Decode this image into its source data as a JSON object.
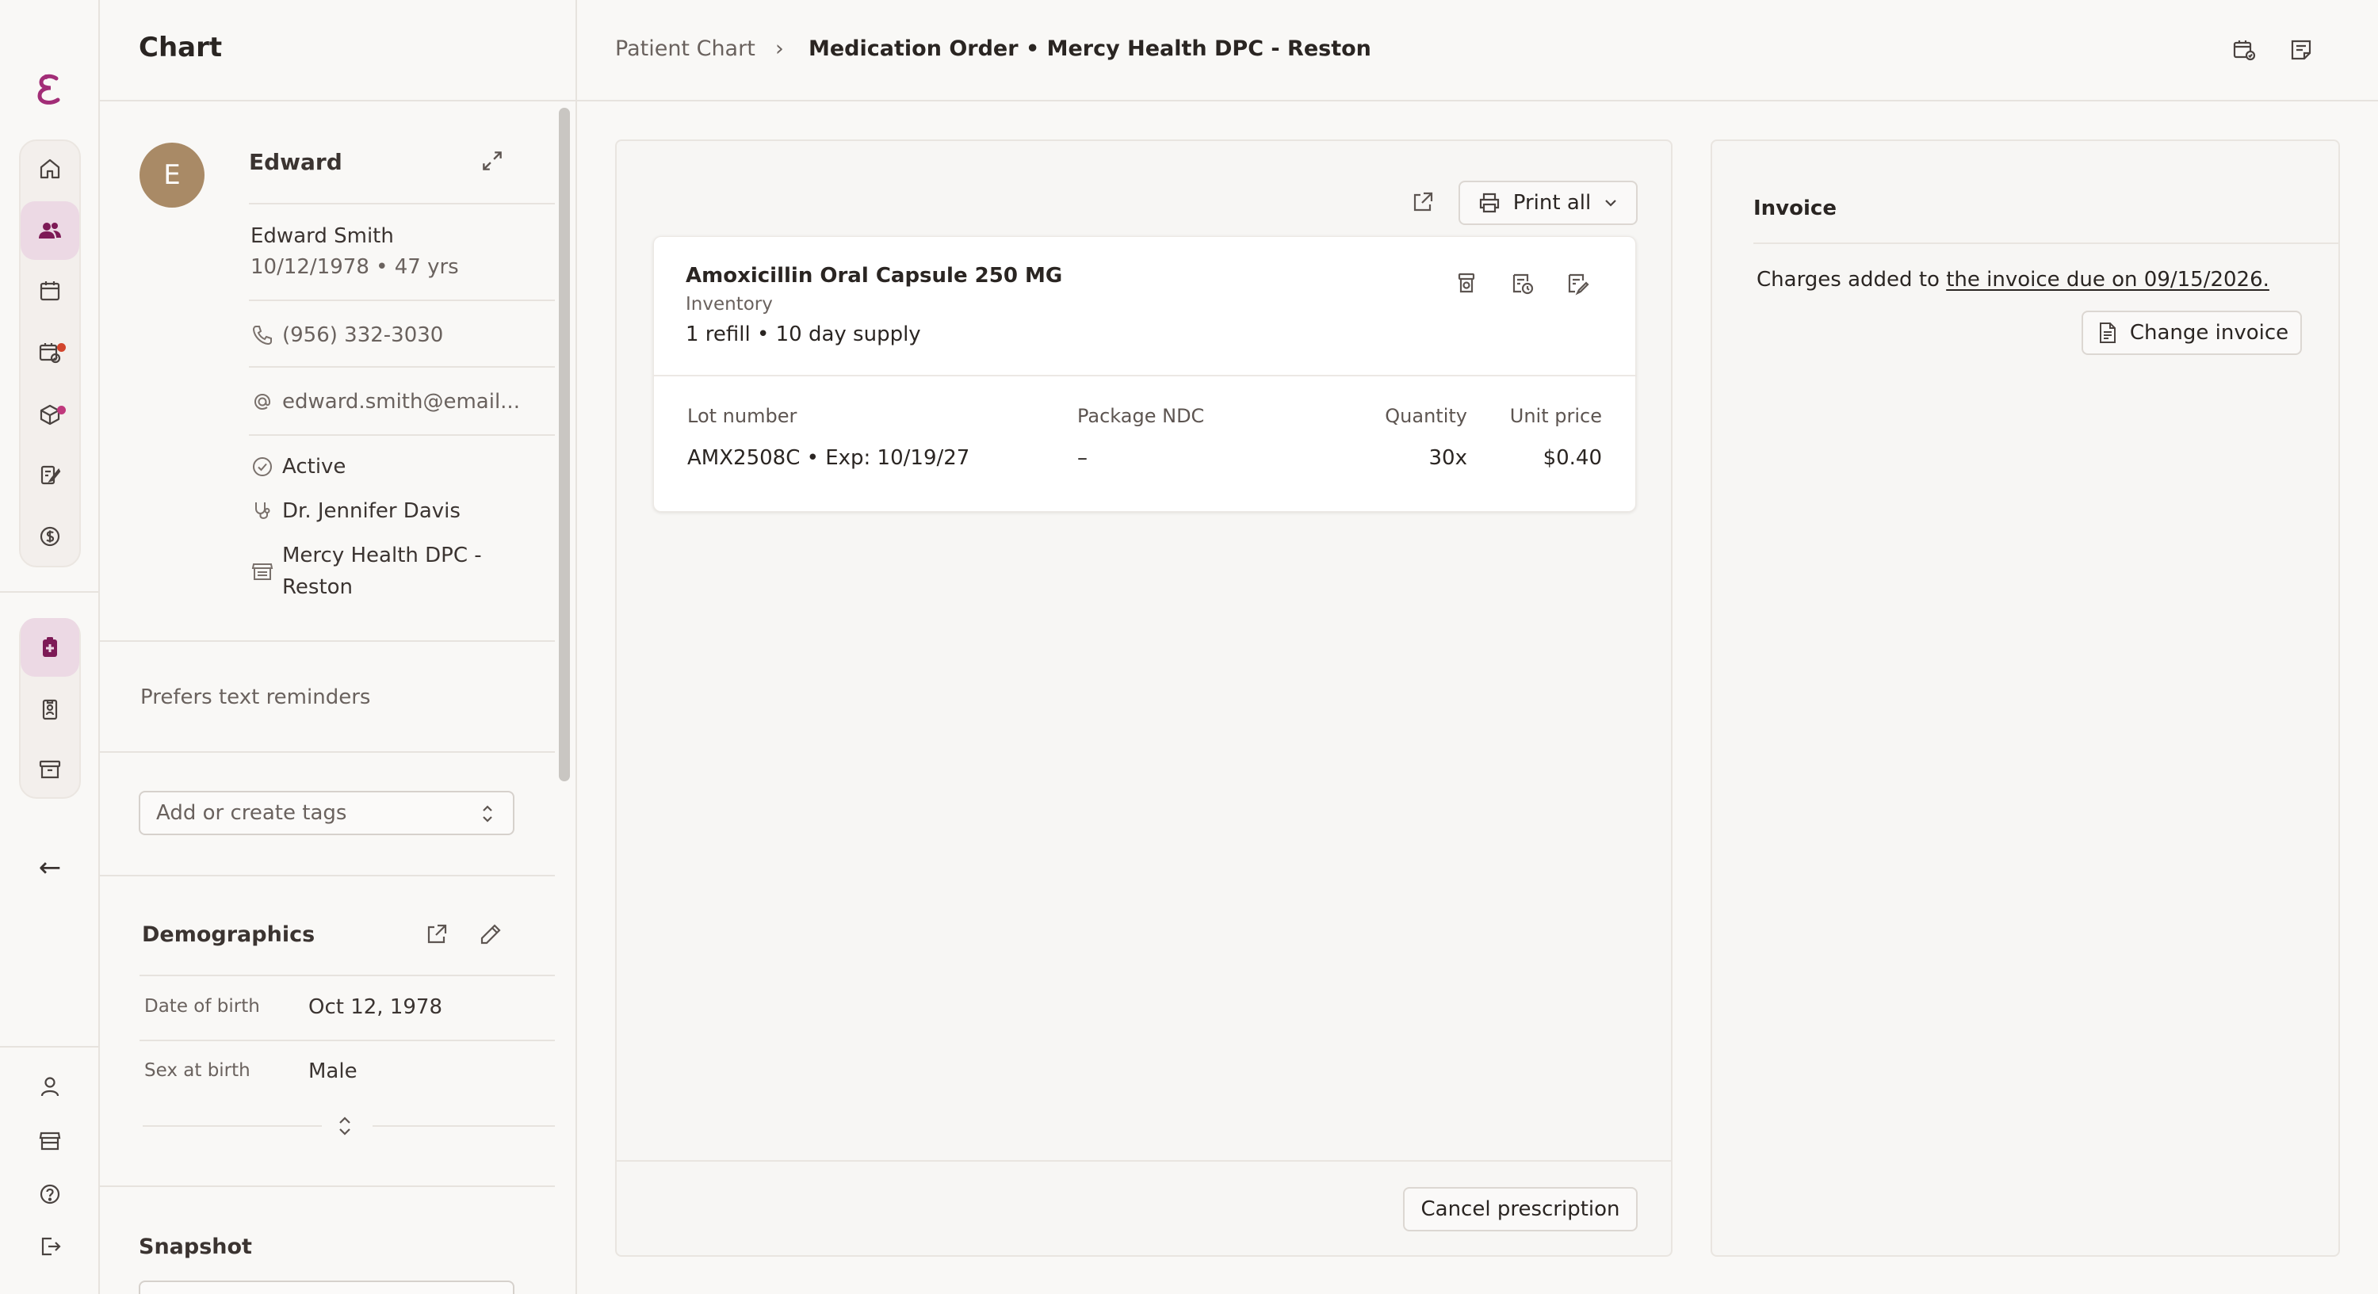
{
  "nav": {
    "logo": "E",
    "accent_color": "#7d1a56",
    "alert_dot_color": "#d2452d",
    "badge_dot_color": "#c0397d",
    "back_arrow": "←"
  },
  "sidebar": {
    "title": "Chart",
    "patient": {
      "avatar_initial": "E",
      "avatar_color": "#a98a66",
      "short_name": "Edward",
      "full_name": "Edward Smith",
      "dob_age": "10/12/1978 • 47 yrs",
      "phone": "(956) 332-3030",
      "email": "edward.smith@email...",
      "status": "Active",
      "provider": "Dr. Jennifer Davis",
      "location_line1": "Mercy Health DPC -",
      "location_line2": "Reston"
    },
    "reminder_note": "Prefers text reminders",
    "tags_placeholder": "Add or create tags",
    "demographics": {
      "title": "Demographics",
      "rows": [
        {
          "label": "Date of birth",
          "value": "Oct 12, 1978"
        },
        {
          "label": "Sex at birth",
          "value": "Male"
        }
      ]
    },
    "snapshot_title": "Snapshot"
  },
  "header": {
    "breadcrumb_parent": "Patient Chart",
    "breadcrumb_separator": "›",
    "breadcrumb_current": "Medication Order • Mercy Health DPC - Reston"
  },
  "order": {
    "print_label": "Print all",
    "medication": {
      "name": "Amoxicillin Oral Capsule 250 MG",
      "source": "Inventory",
      "supply": "1 refill • 10 day supply"
    },
    "table": {
      "headers": [
        "Lot number",
        "Package NDC",
        "Quantity",
        "Unit price"
      ],
      "rows": [
        [
          "AMX2508C • Exp: 10/19/27",
          "–",
          "30x",
          "$0.40"
        ]
      ]
    },
    "cancel_label": "Cancel prescription"
  },
  "invoice": {
    "title": "Invoice",
    "charges_prefix": "Charges added to",
    "invoice_link": "the invoice due on 09/15/2026.",
    "change_label": "Change invoice"
  }
}
